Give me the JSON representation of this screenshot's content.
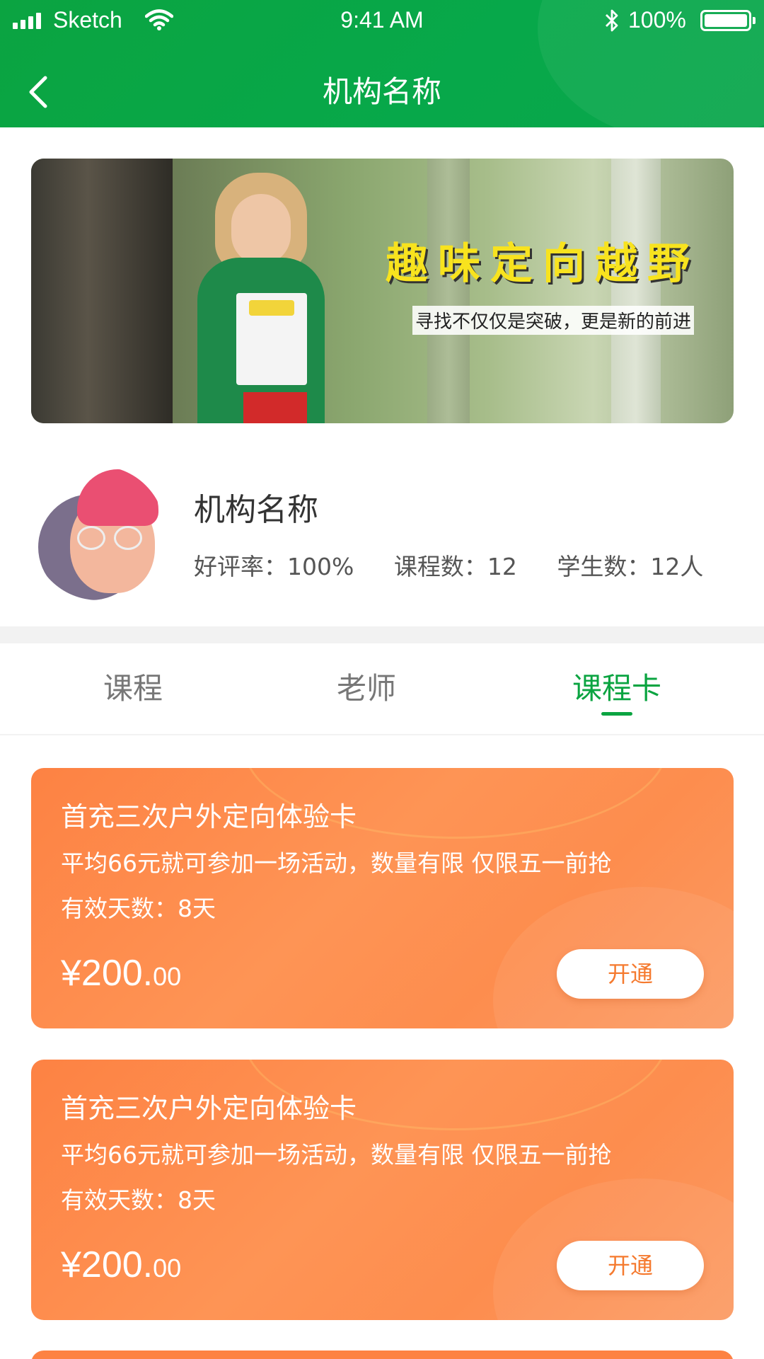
{
  "status_bar": {
    "carrier": "Sketch",
    "time": "9:41 AM",
    "battery": "100%",
    "icons": [
      "signal-icon",
      "wifi-icon",
      "bluetooth-icon",
      "battery-icon"
    ]
  },
  "nav": {
    "title": "机构名称",
    "back_icon": "chevron-left-icon"
  },
  "banner": {
    "title": "趣味定向越野",
    "subtitle": "寻找不仅仅是突破，更是新的前进"
  },
  "org": {
    "name": "机构名称",
    "rating": "好评率：100%",
    "courses": "课程数：12",
    "students": "学生数：12人"
  },
  "tabs": [
    {
      "label": "课程",
      "active": false
    },
    {
      "label": "老师",
      "active": false
    },
    {
      "label": "课程卡",
      "active": true
    }
  ],
  "cards": [
    {
      "title": "首充三次户外定向体验卡",
      "desc": "平均66元就可参加一场活动，数量有限 仅限五一前抢",
      "days": "有效天数：8天",
      "price_main": "¥200.",
      "price_cents": "00",
      "button": "开通"
    },
    {
      "title": "首充三次户外定向体验卡",
      "desc": "平均66元就可参加一场活动，数量有限 仅限五一前抢",
      "days": "有效天数：8天",
      "price_main": "¥200.",
      "price_cents": "00",
      "button": "开通"
    }
  ],
  "colors": {
    "header_green": "#0ba441",
    "accent_green": "#0ba441",
    "card_orange": "#fd8243",
    "button_text_orange": "#f57a2f"
  }
}
